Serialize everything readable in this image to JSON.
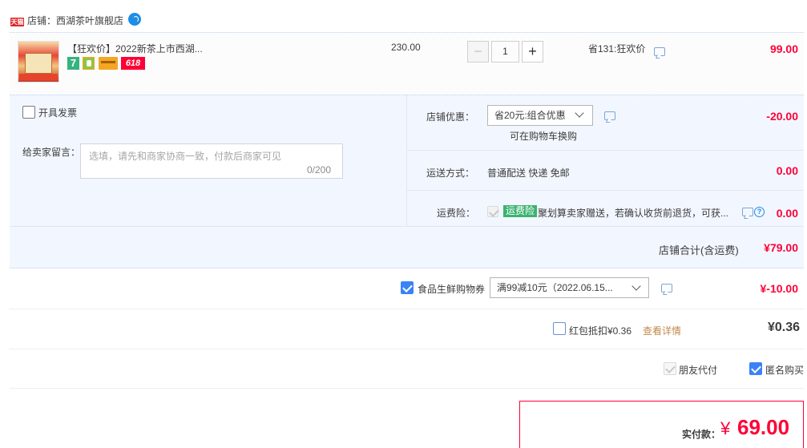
{
  "shop": {
    "badge": "天猫",
    "label": "店铺：西湖茶叶旗舰店"
  },
  "item": {
    "title": "【狂欢价】2022新茶上市西湖...",
    "icon_7": "7",
    "icon_618": "618",
    "unit_price": "230.00",
    "quantity": "1",
    "minus": "−",
    "plus": "+",
    "promo": "省131:狂欢价",
    "total": "99.00"
  },
  "invoice": {
    "label": "开具发票"
  },
  "message": {
    "label": "给卖家留言：",
    "placeholder": "选填，请先和商家协商一致，付款后商家可见",
    "counter": "0/200"
  },
  "shop_discount": {
    "label": "店铺优惠：",
    "selected": "省20元:组合优惠",
    "note": "可在购物车换购",
    "value": "-20.00"
  },
  "shipping": {
    "label": "运送方式：",
    "method": "普通配送 快递 免邮",
    "value": "0.00"
  },
  "freight_insurance": {
    "label": "运费险：",
    "tag": "运费险",
    "text": "聚划算卖家赠送，若确认收货前退货，可获...",
    "value": "0.00"
  },
  "shop_total": {
    "label": "店铺合计(含运费)",
    "value": "¥79.00"
  },
  "coupon": {
    "label": "食品生鲜购物券",
    "selected": "满99减10元（2022.06.15...",
    "value": "¥-10.00"
  },
  "red_packet": {
    "label": "红包抵扣¥0.36",
    "link": "查看详情",
    "value": "¥0.36"
  },
  "options": {
    "friend_pay": "朋友代付",
    "anonymous": "匿名购买"
  },
  "payment": {
    "label": "实付款：",
    "currency": "¥",
    "amount": "69.00"
  },
  "colors": {
    "accent_red": "#ff0036",
    "brand_blue": "#3b82f6",
    "panel_bg": "#f2f7ff"
  }
}
